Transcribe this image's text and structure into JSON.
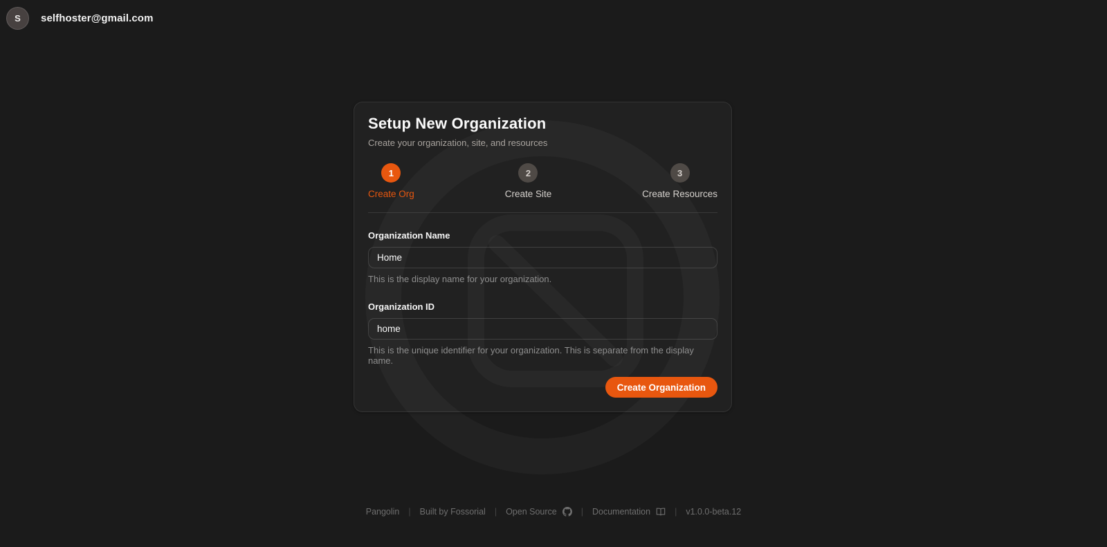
{
  "app": {
    "background_color": "#1b1b1b",
    "accent_color": "#e8570f"
  },
  "header": {
    "avatar_initial": "S",
    "user_email": "selfhoster@gmail.com"
  },
  "wizard": {
    "title": "Setup New Organization",
    "subtitle": "Create your organization, site, and resources",
    "steps": [
      {
        "number": "1",
        "label": "Create Org"
      },
      {
        "number": "2",
        "label": "Create Site"
      },
      {
        "number": "3",
        "label": "Create Resources"
      }
    ],
    "active_step": "1",
    "form": {
      "org_name": {
        "label": "Organization Name",
        "value": "Home",
        "help": "This is the display name for your organization."
      },
      "org_id": {
        "label": "Organization ID",
        "value": "home",
        "help": "This is the unique identifier for your organization. This is separate from the display name."
      },
      "submit_label": "Create Organization"
    }
  },
  "footer": {
    "brand": "Pangolin",
    "built_by": "Built by Fossorial",
    "open_source": "Open Source",
    "documentation": "Documentation",
    "version": "v1.0.0-beta.12",
    "separator": "|"
  }
}
